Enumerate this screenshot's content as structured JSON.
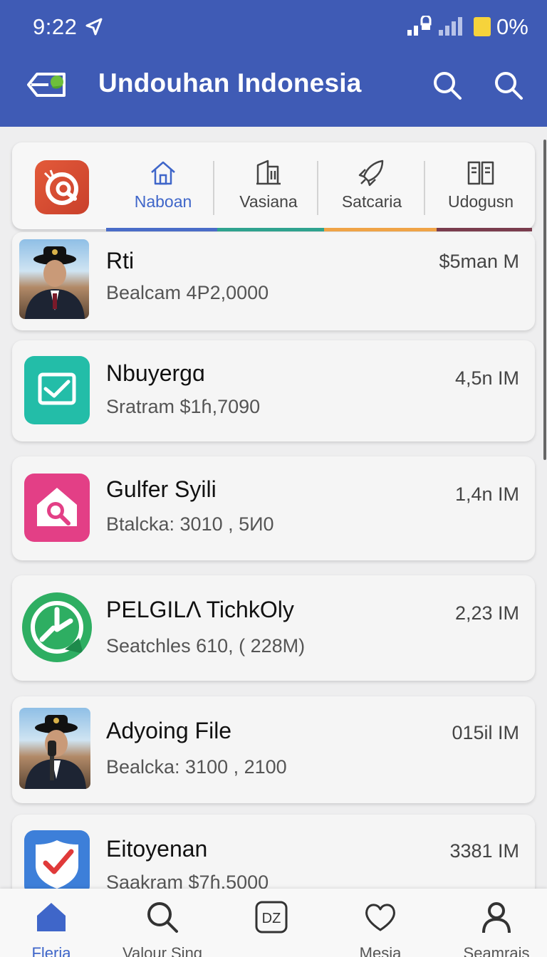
{
  "status": {
    "time": "9:22",
    "battery": "0%"
  },
  "appbar": {
    "title": "Undouhan Indonesia"
  },
  "categories": [
    {
      "label": "Naboan",
      "icon": "home-outline-icon",
      "active": true
    },
    {
      "label": "Vasiana",
      "icon": "building-icon"
    },
    {
      "label": "Satcaria",
      "icon": "rocket-icon"
    },
    {
      "label": "Udogusn",
      "icon": "book-icon"
    }
  ],
  "category_bar_colors": [
    "#4a6cc8",
    "#2fa38f",
    "#f0a447",
    "#7a3d4e"
  ],
  "items": [
    {
      "name": "Rti",
      "subtitle": "Bealcam 4P2,0000",
      "value": "$5man M",
      "icon": "person-photo-icon"
    },
    {
      "name": "Nbuyergɑ",
      "subtitle": "Sratram $1ɦ,7090",
      "value": "4,5n IM",
      "icon": "checkbox-icon",
      "color": "#23bda8"
    },
    {
      "name": "Gulfer Syili",
      "subtitle": "Btalcka: 3010 , 5И0",
      "value": "1,4n IM",
      "icon": "search-house-icon",
      "color": "#e33f86"
    },
    {
      "name": "PELGILΛ TichkOly",
      "subtitle": "Seatchles 610, ( 228M)",
      "value": "2,23 IM",
      "icon": "download-check-icon",
      "color": "#2eae62"
    },
    {
      "name": "Adyoing File",
      "subtitle": "Bealcka: 3100 , 2100",
      "value": "015il IM",
      "icon": "person-microphone-photo-icon"
    },
    {
      "name": "Eitoyenan",
      "subtitle": "Saakram $7ɦ,5000",
      "value": "3381 IM",
      "icon": "verified-check-icon",
      "color": "#3d7fd9"
    }
  ],
  "nav": [
    {
      "label": "Fleria",
      "icon": "home-filled-icon",
      "active": true
    },
    {
      "label": "Valour Sing",
      "icon": "search-icon"
    },
    {
      "label": "",
      "badge": "DZ",
      "icon": "dz-box-icon"
    },
    {
      "label": "Mesia",
      "icon": "heart-icon"
    },
    {
      "label": "Seamrais",
      "icon": "profile-icon"
    }
  ]
}
